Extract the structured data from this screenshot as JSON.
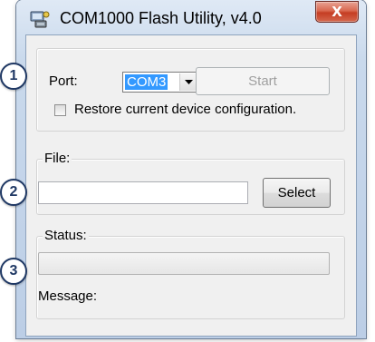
{
  "window": {
    "title": "COM1000 Flash Utility, v4.0",
    "close_glyph": "X"
  },
  "port_group": {
    "port_label": "Port:",
    "port_value": "COM3",
    "start_label": "Start",
    "restore_label": "Restore current device configuration.",
    "restore_checked": false
  },
  "file_group": {
    "label": "File:",
    "file_value": "",
    "select_label": "Select"
  },
  "status_group": {
    "label": "Status:",
    "progress": 0,
    "message_label": "Message:"
  },
  "callouts": [
    "1",
    "2",
    "3"
  ],
  "icons": {
    "app": "flash-utility-icon",
    "close": "close-icon",
    "dropdown": "chevron-down-icon"
  },
  "colors": {
    "selection": "#3399ff",
    "close_button": "#c53d23",
    "callout_border": "#1f3864"
  }
}
